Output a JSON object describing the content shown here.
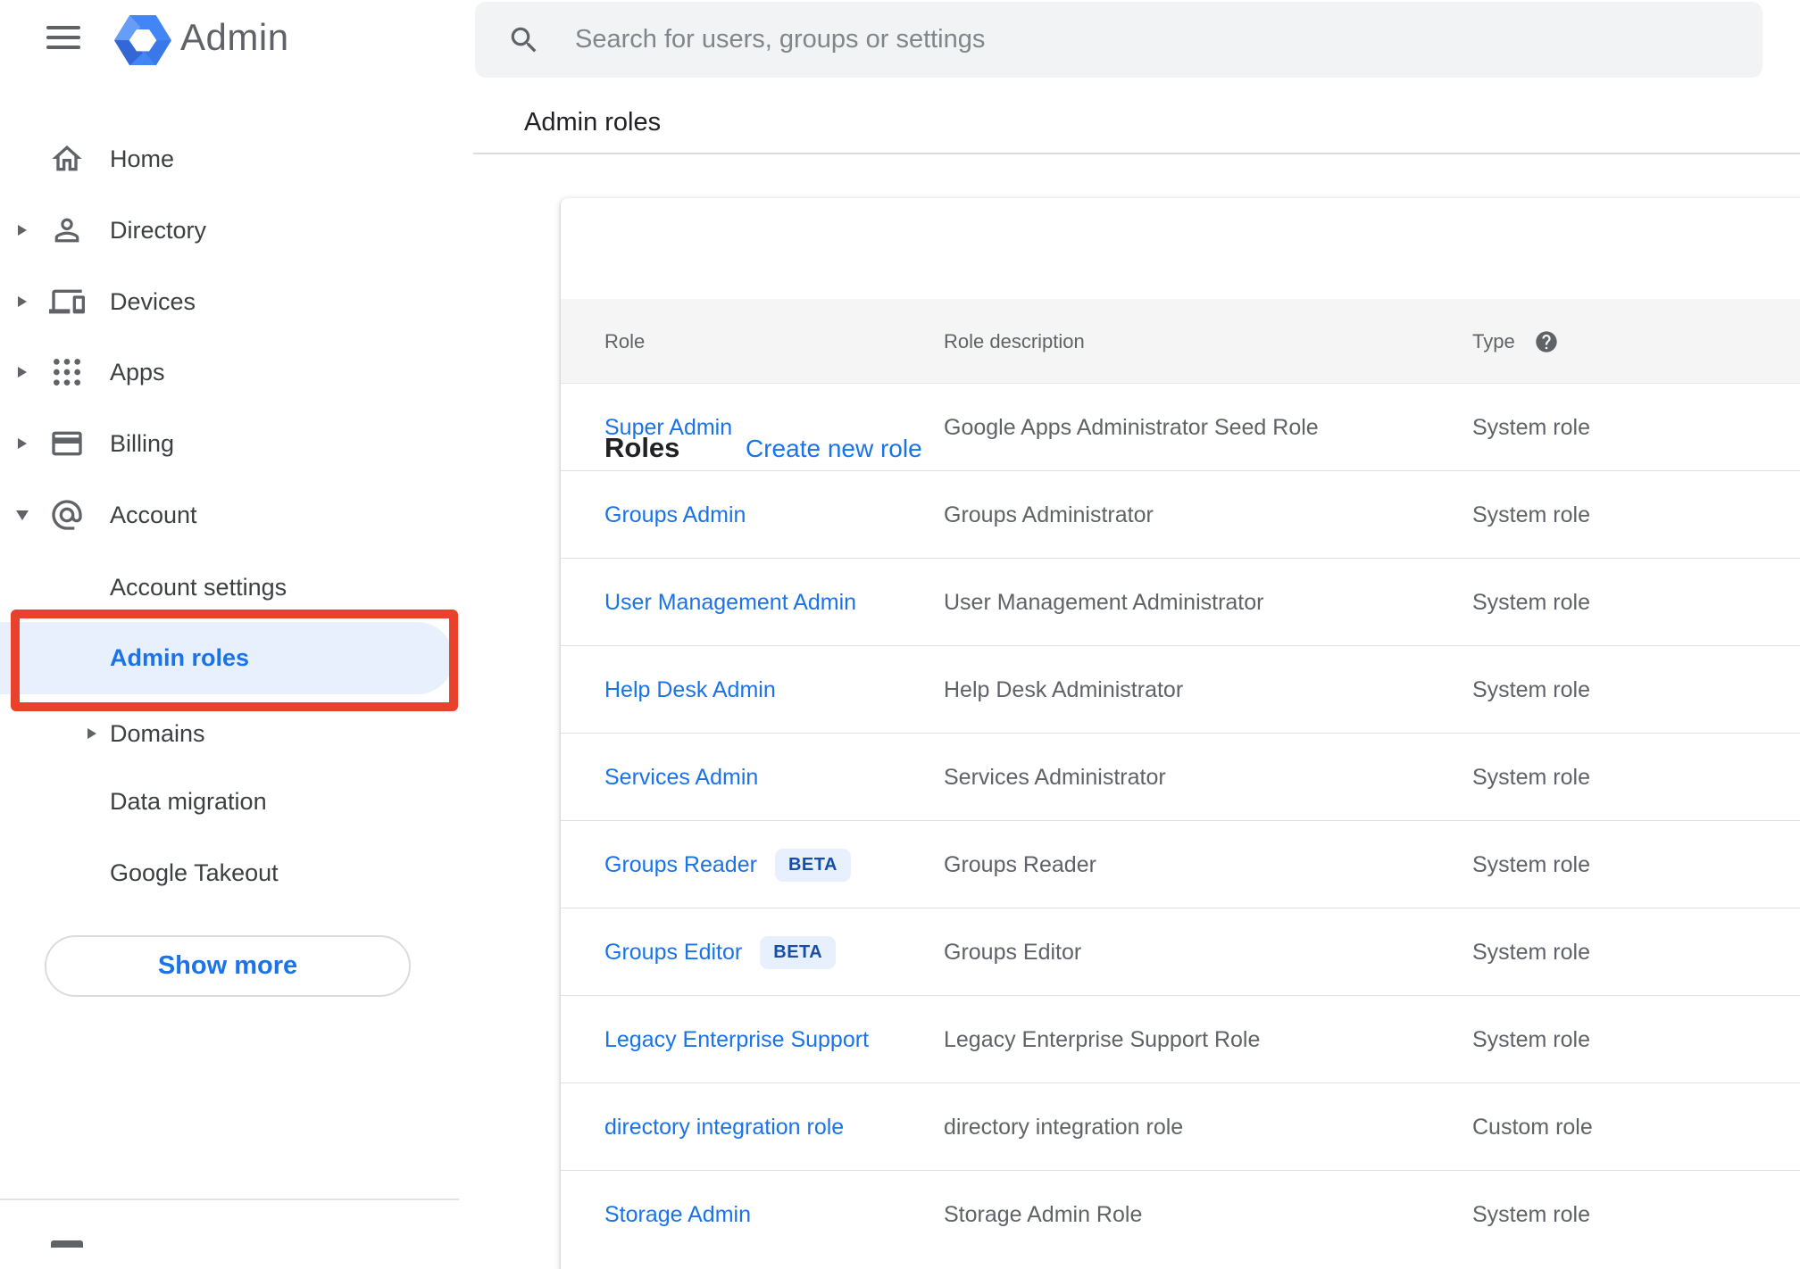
{
  "app": {
    "name": "Admin"
  },
  "topbar": {
    "search_placeholder": "Search for users, groups or settings"
  },
  "breadcrumb": "Admin roles",
  "sidebar": {
    "items": [
      {
        "label": "Home",
        "icon": "home-icon",
        "expandable": false
      },
      {
        "label": "Directory",
        "icon": "person-icon",
        "expandable": true
      },
      {
        "label": "Devices",
        "icon": "devices-icon",
        "expandable": true
      },
      {
        "label": "Apps",
        "icon": "apps-grid-icon",
        "expandable": true
      },
      {
        "label": "Billing",
        "icon": "credit-card-icon",
        "expandable": true
      },
      {
        "label": "Account",
        "icon": "at-sign-icon",
        "expandable": true,
        "expanded": true
      }
    ],
    "account_children": [
      {
        "label": "Account settings"
      },
      {
        "label": "Admin roles",
        "active": true
      },
      {
        "label": "Domains",
        "expandable": true
      },
      {
        "label": "Data migration"
      },
      {
        "label": "Google Takeout"
      }
    ],
    "show_more_label": "Show more"
  },
  "annotation": {
    "shape": "red-box",
    "target": "Admin roles",
    "color": "#e8412c"
  },
  "main": {
    "card_title": "Roles",
    "create_link": "Create new role",
    "table": {
      "columns": [
        "Role",
        "Role description",
        "Type"
      ],
      "type_help_icon": "question-mark-circle",
      "rows": [
        {
          "role": "Super Admin",
          "badge": "",
          "description": "Google Apps Administrator Seed Role",
          "type": "System role"
        },
        {
          "role": "Groups Admin",
          "badge": "",
          "description": "Groups Administrator",
          "type": "System role"
        },
        {
          "role": "User Management Admin",
          "badge": "",
          "description": "User Management Administrator",
          "type": "System role"
        },
        {
          "role": "Help Desk Admin",
          "badge": "",
          "description": "Help Desk Administrator",
          "type": "System role"
        },
        {
          "role": "Services Admin",
          "badge": "",
          "description": "Services Administrator",
          "type": "System role"
        },
        {
          "role": "Groups Reader",
          "badge": "BETA",
          "description": "Groups Reader",
          "type": "System role"
        },
        {
          "role": "Groups Editor",
          "badge": "BETA",
          "description": "Groups Editor",
          "type": "System role"
        },
        {
          "role": "Legacy Enterprise Support",
          "badge": "",
          "description": "Legacy Enterprise Support Role",
          "type": "System role"
        },
        {
          "role": "directory integration role",
          "badge": "",
          "description": "directory integration role",
          "type": "Custom role"
        },
        {
          "role": "Storage Admin",
          "badge": "",
          "description": "Storage Admin Role",
          "type": "System role"
        }
      ]
    }
  },
  "colors": {
    "accent_blue": "#1a73e8",
    "active_pill_bg": "#e8f0fe",
    "annotation_red": "#e8412c",
    "beta_badge_bg": "#e8f0fe",
    "beta_badge_text": "#174ea6",
    "icon_gray": "#5f6368",
    "text_dark": "#202124",
    "table_header_bg": "#f5f5f6",
    "search_bg": "#f1f3f4"
  }
}
